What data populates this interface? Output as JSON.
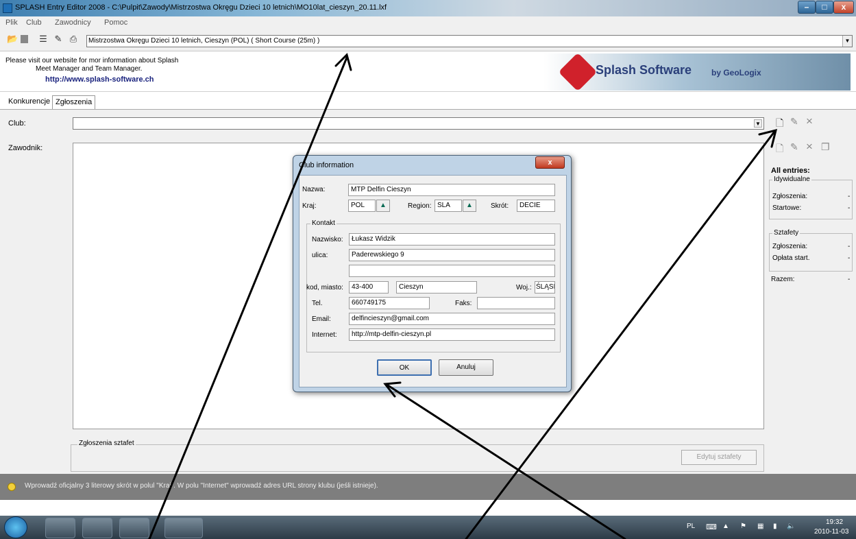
{
  "window": {
    "title": "SPLASH Entry Editor 2008 - C:\\Pulpit\\Zawody\\Mistrzostwa Okręgu Dzieci 10 letnich\\MO10lat_cieszyn_20.11.lxf",
    "minimize": "–",
    "maximize": "□",
    "close": "x"
  },
  "menu": [
    "Plik",
    "Club",
    "Zawodnicy",
    "Pomoc"
  ],
  "toolbar": {
    "meet": "Mistrzostwa Okręgu Dzieci 10 letnich,  Cieszyn  (POL)  ( Short Course (25m) )",
    "icons": [
      "open-icon",
      "save-icon",
      "properties-icon",
      "tools-icon",
      "print-icon"
    ]
  },
  "info": {
    "line1": "Please visit our website for mor information about Splash",
    "line2": "Meet Manager and Team Manager.",
    "link": "http://www.splash-software.ch",
    "banner_brand": "Splash Software",
    "banner_by": "by GeoLogix"
  },
  "tabs": [
    "Konkurencje",
    "Zgłoszenia"
  ],
  "form": {
    "club_label": "Club:",
    "swimmer_label": "Zawodnik:",
    "relay_entries_title": "Zgłoszenia sztafet",
    "edit_relay_button": "Edytuj sztafety"
  },
  "summary": {
    "title": "All entries:",
    "individual_title": "Idywidualne",
    "ind_entries_label": "Zgłoszenia:",
    "ind_entries_value": "-",
    "ind_starts_label": "Startowe:",
    "ind_starts_value": "-",
    "relays_title": "Sztafety",
    "rel_entries_label": "Zgłoszenia:",
    "rel_entries_value": "-",
    "rel_fee_label": "Opłata start.",
    "rel_fee_value": "-",
    "total_label": "Razem:",
    "total_value": "-"
  },
  "status": {
    "text": "Wprowadź oficjalny 3 literowy skrót w polul \"Kraj\". W polu \"Internet\" wprowadź adres URL strony klubu (jeśli istnieje)."
  },
  "dialog": {
    "title": "Club information",
    "close": "x",
    "name_label": "Nazwa:",
    "name_value": "MTP Delfin Cieszyn",
    "country_label": "Kraj:",
    "country_value": "POL",
    "region_label": "Region:",
    "region_value": "SLA",
    "short_label": "Skrót:",
    "short_value": "DECIE",
    "contact_title": "Kontakt",
    "surname_label": "Nazwisko:",
    "surname_value": "Łukasz Widzik",
    "street_label": "ulica:",
    "street_value": "Paderewskiego 9",
    "street2_value": "",
    "zipcity_label": "kod, miasto:",
    "zip_value": "43-400",
    "city_value": "Cieszyn",
    "state_label": "Woj.:",
    "state_value": "ŚLĄSK",
    "tel_label": "Tel.",
    "tel_value": "660749175",
    "fax_label": "Faks:",
    "fax_value": "",
    "email_label": "Email:",
    "email_value": "delfincieszyn@gmail.com",
    "internet_label": "Internet:",
    "internet_value": "http://mtp-delfin-cieszyn.pl",
    "ok": "OK",
    "cancel": "Anuluj"
  },
  "taskbar": {
    "lang": "PL",
    "time": "19:32",
    "date": "2010-11-03"
  }
}
